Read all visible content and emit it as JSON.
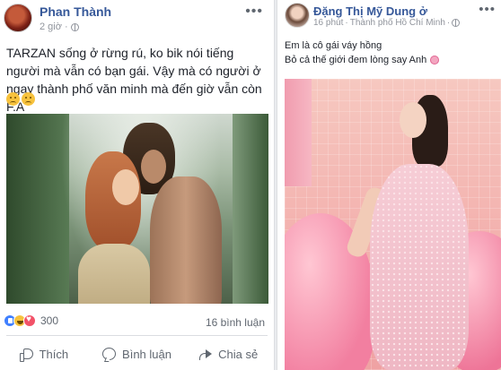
{
  "left_post": {
    "author": "Phan Thành",
    "time": "2 giờ",
    "more": "•••",
    "text": "TARZAN sống ở rừng rú, ko bik nói tiếng người mà vẫn có bạn gái. Vậy mà có người ở ngay thành phố văn minh mà đến giờ vẫn còn F.A",
    "reaction_count": "300",
    "comment_count": "16 bình luận",
    "actions": {
      "like": "Thích",
      "comment": "Bình luận",
      "share": "Chia sẻ"
    },
    "icons": [
      "globe-icon",
      "like-reaction-icon",
      "haha-reaction-icon",
      "love-reaction-icon",
      "sad-emoji-icon",
      "thumb-up-icon",
      "comment-icon",
      "share-icon"
    ]
  },
  "right_post": {
    "author": "Đặng Thị Mỹ Dung ở",
    "time": "16 phút",
    "separator": "·",
    "location": "Thành phố Hồ Chí Minh",
    "more": "•••",
    "line1": "Em là cô gái váy hồng",
    "line2": "Bỏ cả thế giới đem lòng say Anh",
    "icons": [
      "globe-icon",
      "flower-emoji-icon"
    ]
  },
  "colors": {
    "link_blue": "#365899",
    "meta_gray": "#90949c",
    "action_gray": "#606770",
    "like_blue": "#4080ff",
    "love_red": "#f25268",
    "haha_yellow": "#f7c23d"
  }
}
